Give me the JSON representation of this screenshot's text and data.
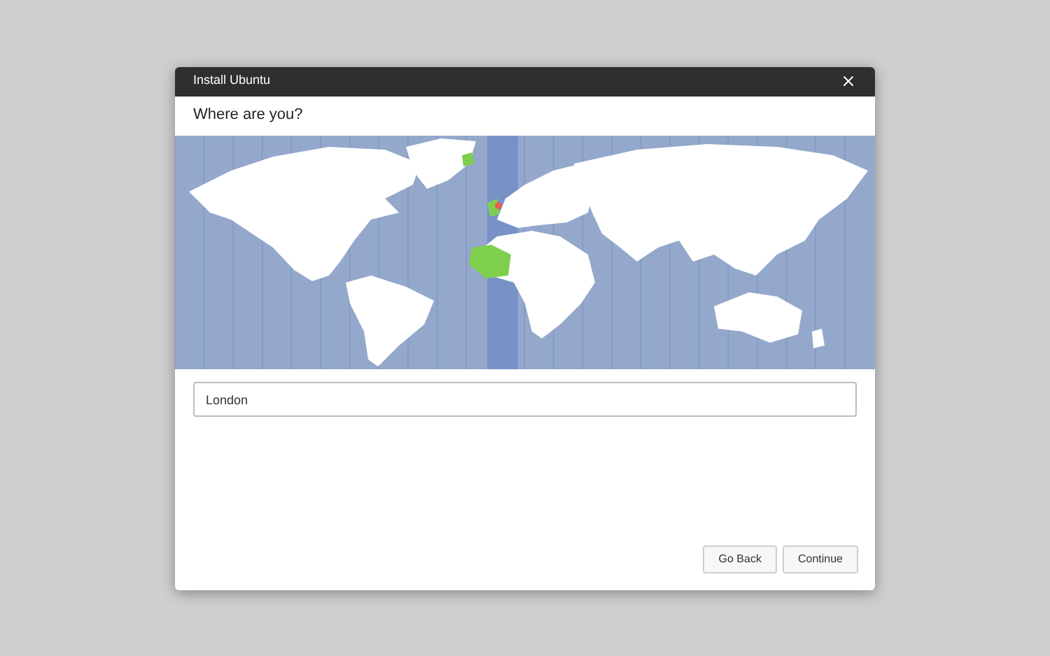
{
  "window": {
    "title": "Install Ubuntu"
  },
  "heading": "Where are you?",
  "location_field": {
    "value": "London"
  },
  "buttons": [
    {
      "label": "Go Back"
    },
    {
      "label": "Continue"
    }
  ]
}
